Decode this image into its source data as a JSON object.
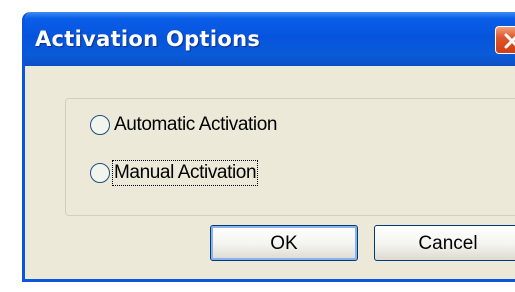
{
  "window": {
    "title": "Activation Options",
    "close_icon": "close-icon"
  },
  "options": [
    {
      "label": "Automatic Activation",
      "selected": false
    },
    {
      "label": "Manual Activation",
      "selected": false
    }
  ],
  "buttons": {
    "ok_label": "OK",
    "cancel_label": "Cancel"
  },
  "colors": {
    "titlebar": "#0654dd",
    "dialog_background": "#ece9d8",
    "close_button": "#e0562a"
  }
}
